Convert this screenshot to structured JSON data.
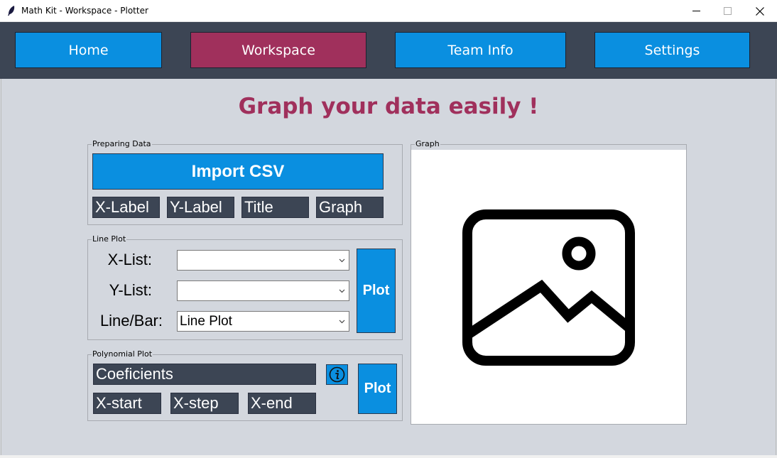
{
  "window": {
    "title": "Math Kit - Workspace - Plotter"
  },
  "nav": {
    "home": "Home",
    "workspace": "Workspace",
    "team_info": "Team Info",
    "settings": "Settings"
  },
  "heading": "Graph your data easily !",
  "preparing": {
    "label": "Preparing Data",
    "import_button": "Import CSV",
    "x_label": "X-Label",
    "y_label": "Y-Label",
    "title": "Title",
    "graph": "Graph"
  },
  "line_plot": {
    "label": "Line Plot",
    "x_list_label": "X-List:",
    "y_list_label": "Y-List:",
    "type_label": "Line/Bar:",
    "x_list_value": "",
    "y_list_value": "",
    "type_value": "Line Plot",
    "plot_button": "Plot"
  },
  "poly_plot": {
    "label": "Polynomial Plot",
    "coefficients": "Coeficients",
    "x_start": "X-start",
    "x_step": "X-step",
    "x_end": "X-end",
    "plot_button": "Plot"
  },
  "graph": {
    "label": "Graph",
    "placeholder_icon": "image-icon"
  },
  "colors": {
    "accent": "#0a8fe0",
    "active": "#a0305c",
    "nav_bg": "#3c4554",
    "bg": "#d3d7de"
  }
}
